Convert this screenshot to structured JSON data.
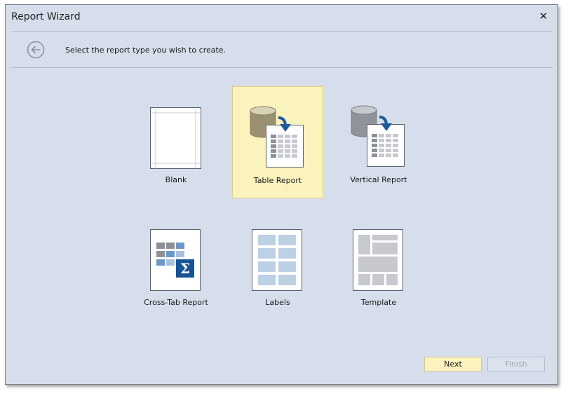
{
  "window": {
    "title": "Report Wizard",
    "close_glyph": "✕"
  },
  "header": {
    "prompt": "Select the report type you wish to create.",
    "back_icon": "back-arrow-icon"
  },
  "report_types": [
    {
      "label": "Blank",
      "icon": "blank-report-icon",
      "selected": false
    },
    {
      "label": "Table Report",
      "icon": "table-report-icon",
      "selected": true
    },
    {
      "label": "Vertical Report",
      "icon": "vertical-report-icon",
      "selected": false
    },
    {
      "label": "Cross-Tab Report",
      "icon": "cross-tab-report-icon",
      "selected": false
    },
    {
      "label": "Labels",
      "icon": "labels-report-icon",
      "selected": false
    },
    {
      "label": "Template",
      "icon": "template-report-icon",
      "selected": false
    }
  ],
  "buttons": {
    "next": "Next",
    "finish": "Finish",
    "finish_enabled": false
  },
  "colors": {
    "background": "#d6deeb",
    "selection": "#fbf3be",
    "accent_blue": "#1f5b9b",
    "cross_tab_sigma": "#155394"
  }
}
